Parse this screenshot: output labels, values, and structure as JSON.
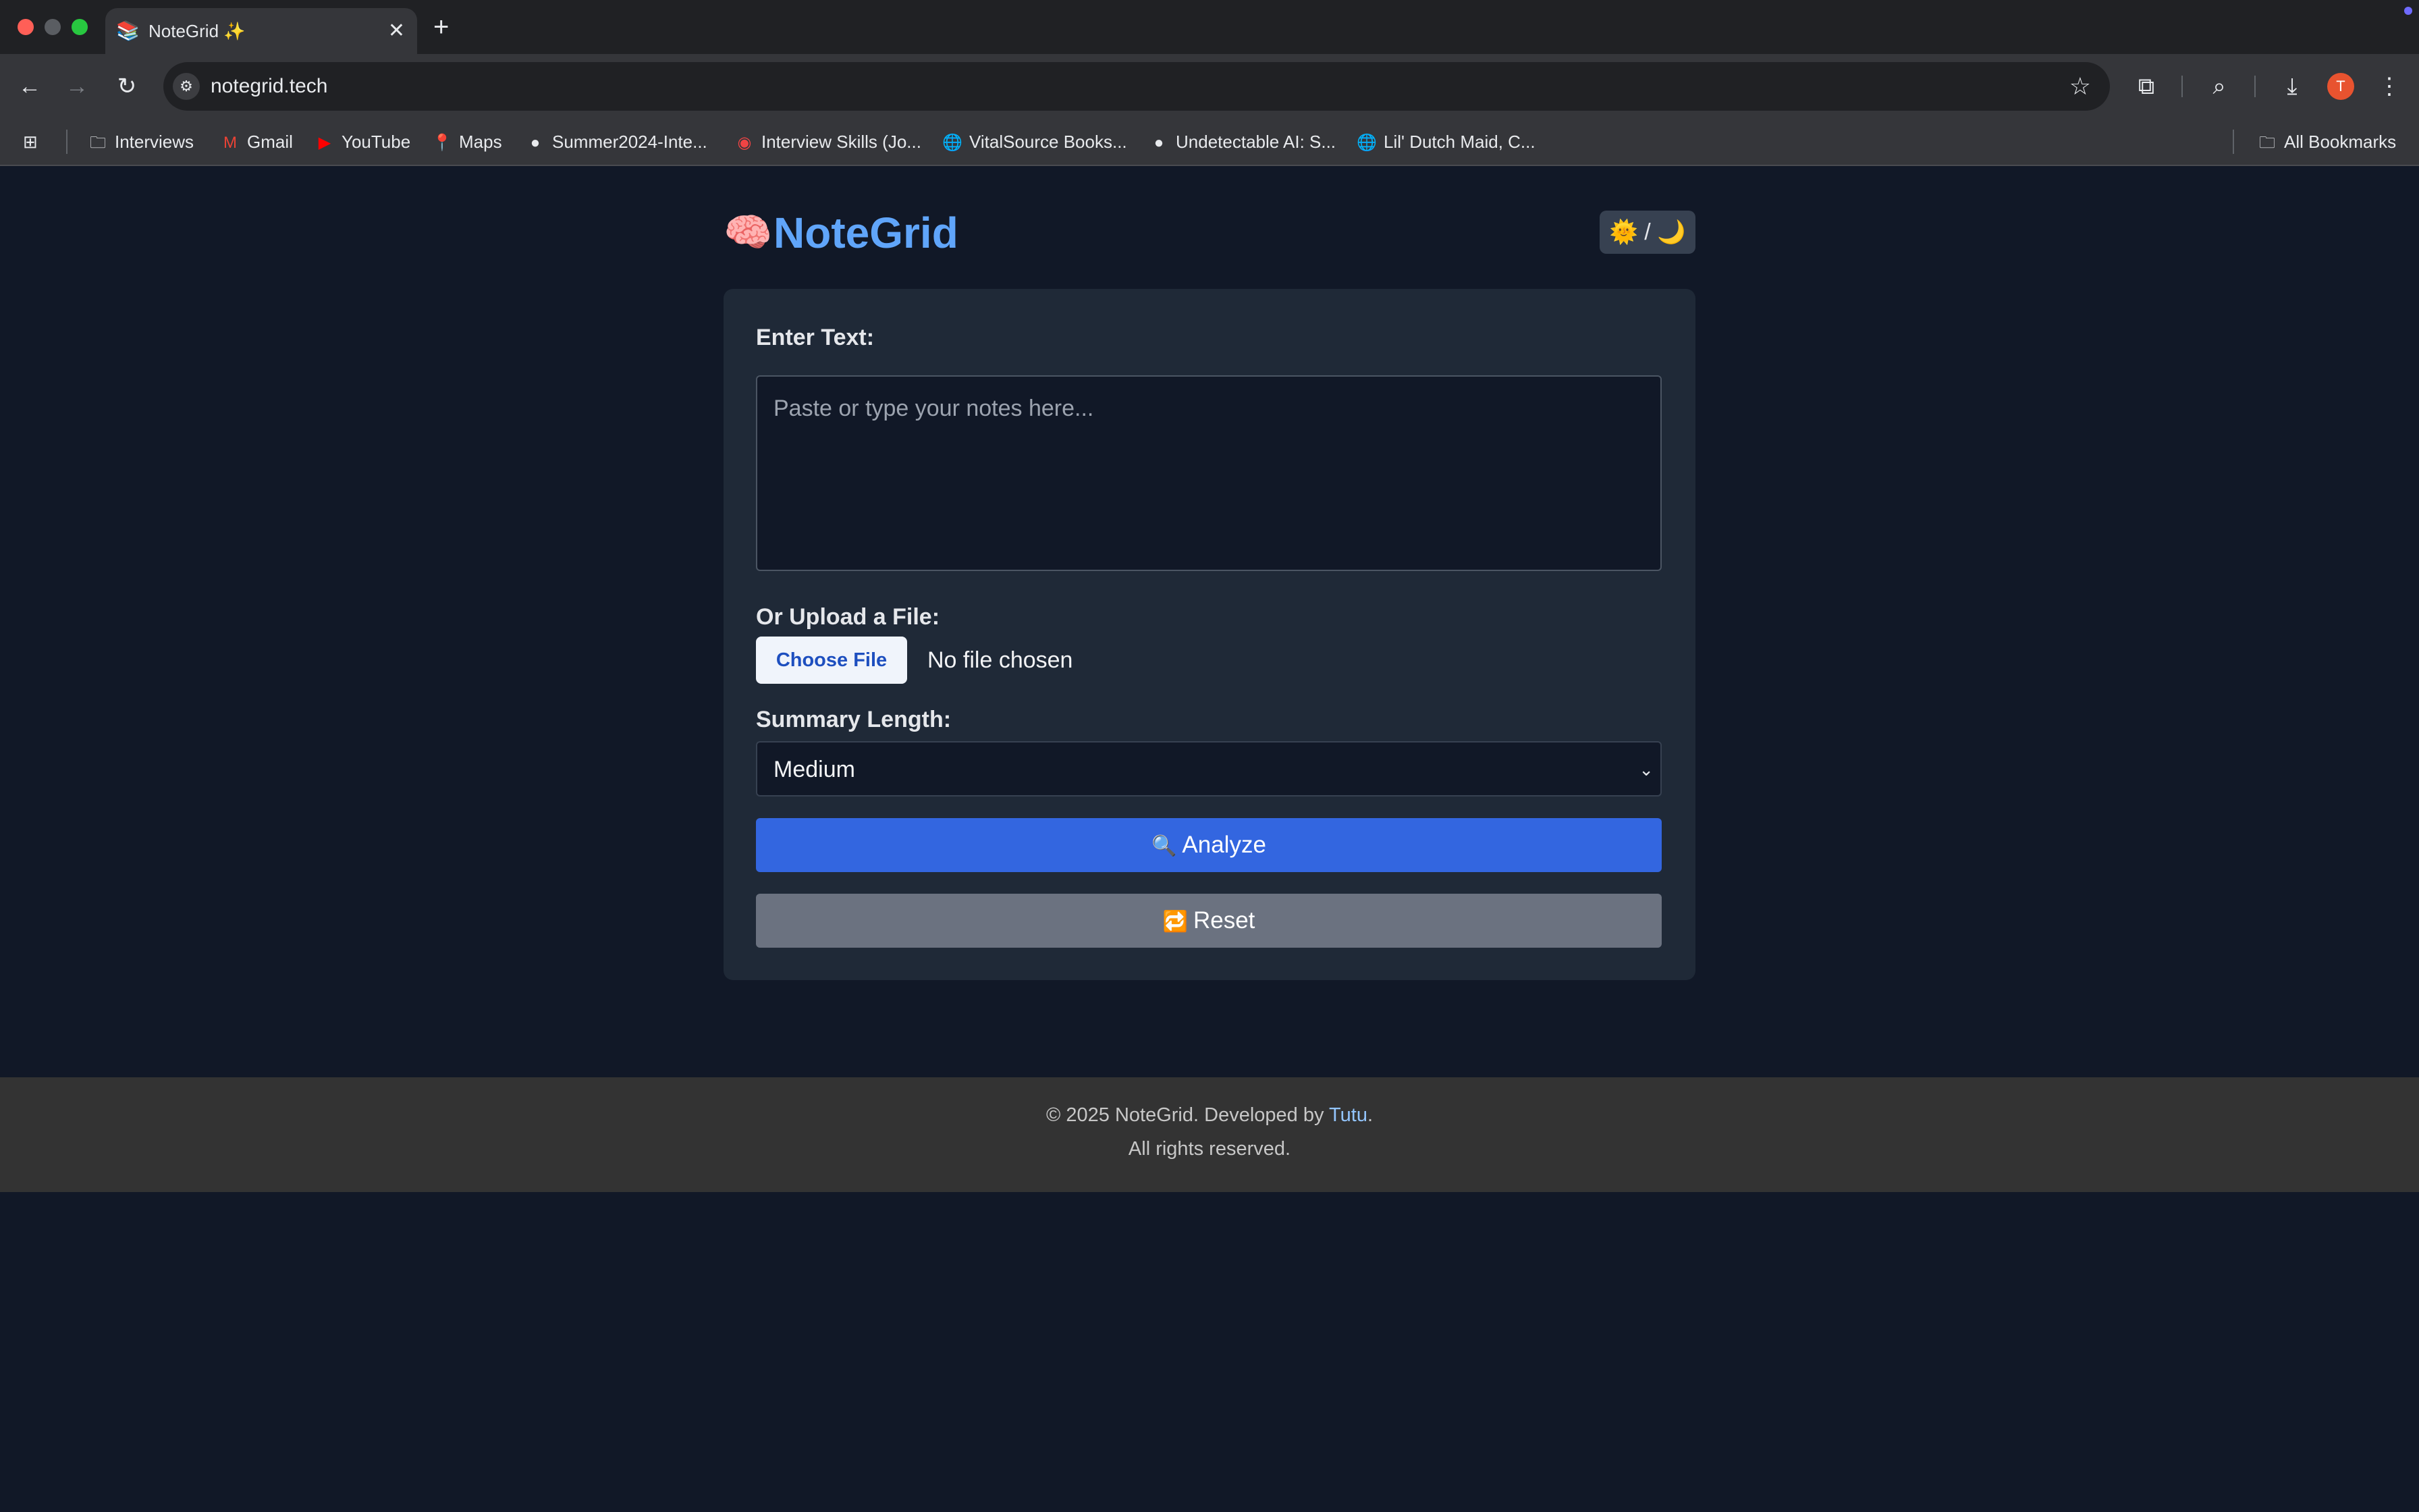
{
  "browser": {
    "tab": {
      "favicon": "📚",
      "title": "NoteGrid ✨",
      "close": "✕"
    },
    "new_tab": "+",
    "url": "notegrid.tech",
    "avatar_initial": "T",
    "bookmarks": [
      {
        "icon": "folder-icon",
        "glyph": "🗀",
        "label": "Interviews"
      },
      {
        "icon": "gmail-icon",
        "glyph": "M",
        "label": "Gmail"
      },
      {
        "icon": "youtube-icon",
        "glyph": "▶",
        "label": "YouTube"
      },
      {
        "icon": "maps-icon",
        "glyph": "📍",
        "label": "Maps"
      },
      {
        "icon": "github-icon",
        "glyph": "●",
        "label": "Summer2024-Inte..."
      },
      {
        "icon": "site-icon",
        "glyph": "◉",
        "label": "Interview Skills (Jo..."
      },
      {
        "icon": "globe-icon",
        "glyph": "🌐",
        "label": "VitalSource Books..."
      },
      {
        "icon": "site-icon",
        "glyph": "●",
        "label": "Undetectable AI: S..."
      },
      {
        "icon": "globe-icon",
        "glyph": "🌐",
        "label": "Lil' Dutch Maid, C..."
      }
    ],
    "all_bookmarks": "All Bookmarks"
  },
  "header": {
    "logo_emoji": "🧠",
    "title": "NoteGrid",
    "theme_toggle": "🌞 / 🌙"
  },
  "form": {
    "text_label": "Enter Text:",
    "text_placeholder": "Paste or type your notes here...",
    "text_value": "",
    "upload_label": "Or Upload a File:",
    "choose_file": "Choose File",
    "no_file": "No file chosen",
    "summary_label": "Summary Length:",
    "summary_selected": "Medium",
    "analyze_icon": "🔍",
    "analyze_label": "Analyze",
    "reset_icon": "🔁",
    "reset_label": "Reset"
  },
  "footer": {
    "line1_prefix": "© 2025 NoteGrid. Developed by ",
    "author": "Tutu",
    "line1_suffix": ".",
    "line2": "All rights reserved."
  },
  "colors": {
    "page_bg": "#111827",
    "card_bg": "#1f2937",
    "brand": "#60a5fa",
    "analyze_button": "#3366e0",
    "reset_button": "#6b7280",
    "footer_bg": "#333333"
  }
}
